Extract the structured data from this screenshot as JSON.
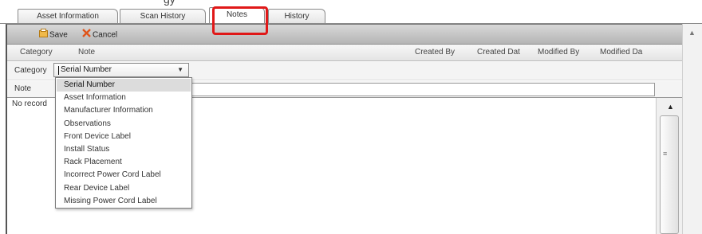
{
  "tabs": [
    {
      "label": "Asset Information"
    },
    {
      "label": "Scan History"
    },
    {
      "label": "Notes"
    },
    {
      "label": "History"
    }
  ],
  "active_tab": "Notes",
  "toolbar": {
    "save_label": "Save",
    "cancel_label": "Cancel"
  },
  "grid": {
    "columns": [
      "Category",
      "Note",
      "Created By",
      "Created Dat",
      "Modified By",
      "Modified Da"
    ],
    "empty_text": "No record"
  },
  "form": {
    "category_label": "Category",
    "category_value": "Serial Number",
    "note_label": "Note",
    "note_value": ""
  },
  "category_options": [
    "Serial Number",
    "Asset Information",
    "Manufacturer Information",
    "Observations",
    "Front Device Label",
    "Install Status",
    "Rack Placement",
    "Incorrect Power Cord Label",
    "Rear Device Label",
    "Missing Power Cord Label"
  ],
  "colors": {
    "highlight": "#e01818",
    "toolbar_top": "#d8d8d8",
    "toolbar_bottom": "#b5b5b5"
  }
}
